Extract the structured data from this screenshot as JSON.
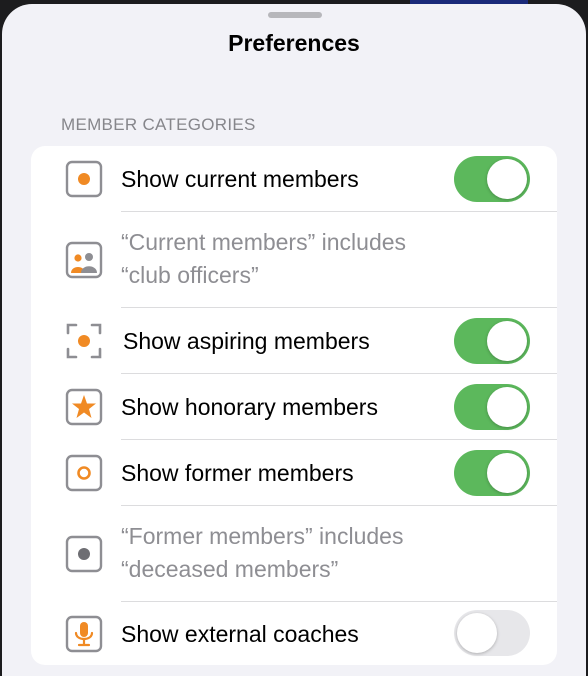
{
  "sheet": {
    "title": "Preferences",
    "section_header": "MEMBER CATEGORIES"
  },
  "colors": {
    "accent": "#f08a24",
    "toggle_on": "#5cb85c",
    "toggle_off": "#e7e7ea",
    "secondary_text": "#8e8e93"
  },
  "rows": [
    {
      "icon": "filled-dot-square-icon",
      "label": "Show current members",
      "toggle": true
    },
    {
      "icon": "people-photo-icon",
      "note_line1": "“Current members” includes",
      "note_line2": "“club officers”"
    },
    {
      "icon": "focus-brackets-dot-icon",
      "label": "Show aspiring members",
      "toggle": true
    },
    {
      "icon": "star-square-icon",
      "label": "Show honorary members",
      "toggle": true
    },
    {
      "icon": "hollow-circle-square-icon",
      "label": "Show former members",
      "toggle": true
    },
    {
      "icon": "gray-dot-square-icon",
      "note_line1": "“Former members” includes",
      "note_line2": "“deceased members”"
    },
    {
      "icon": "microphone-square-icon",
      "label": "Show external coaches",
      "toggle": false
    }
  ]
}
